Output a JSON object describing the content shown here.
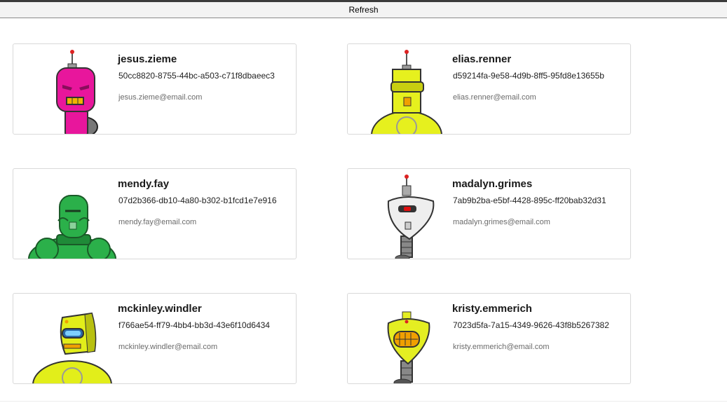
{
  "toolbar": {
    "refresh_label": "Refresh"
  },
  "users": [
    {
      "username": "jesus.zieme",
      "uuid": "50cc8820-8755-44bc-a503-c71f8dbaeec3",
      "email": "jesus.zieme@email.com",
      "robot_color": "#e8169c",
      "robot_icon": "robot-avatar-icon"
    },
    {
      "username": "elias.renner",
      "uuid": "d59214fa-9e58-4d9b-8ff5-95fd8e13655b",
      "email": "elias.renner@email.com",
      "robot_color": "#e6f01e",
      "robot_icon": "robot-avatar-icon"
    },
    {
      "username": "mendy.fay",
      "uuid": "07d2b366-db10-4a80-b302-b1fcd1e7e916",
      "email": "mendy.fay@email.com",
      "robot_color": "#2bb04a",
      "robot_icon": "robot-avatar-icon"
    },
    {
      "username": "madalyn.grimes",
      "uuid": "7ab9b2ba-e5bf-4428-895c-ff20bab32d31",
      "email": "madalyn.grimes@email.com",
      "robot_color": "#eeeeee",
      "robot_icon": "robot-avatar-icon"
    },
    {
      "username": "mckinley.windler",
      "uuid": "f766ae54-ff79-4bb4-bb3d-43e6f10d6434",
      "email": "mckinley.windler@email.com",
      "robot_color": "#e2ee1a",
      "robot_icon": "robot-avatar-icon"
    },
    {
      "username": "kristy.emmerich",
      "uuid": "7023d5fa-7a15-4349-9626-43f8b5267382",
      "email": "kristy.emmerich@email.com",
      "robot_color": "#e4ee22",
      "robot_icon": "robot-avatar-icon"
    }
  ]
}
